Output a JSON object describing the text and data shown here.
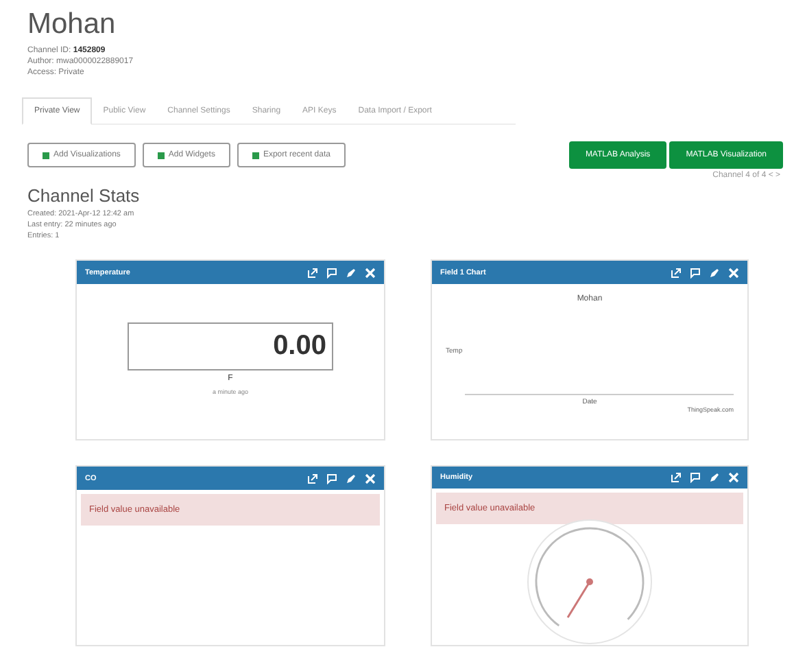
{
  "channel": {
    "name": "Mohan",
    "id_label": "Channel ID: ",
    "id": "1452809",
    "author": "Author: mwa0000022889017",
    "access": "Access: Private"
  },
  "tabs": [
    {
      "label": "Private View",
      "selected": true
    },
    {
      "label": "Public View",
      "selected": false
    },
    {
      "label": "Channel Settings",
      "selected": false
    },
    {
      "label": "Sharing",
      "selected": false
    },
    {
      "label": "API Keys",
      "selected": false
    },
    {
      "label": "Data Import / Export",
      "selected": false
    }
  ],
  "actions": [
    "Add Visualizations",
    "Add Widgets",
    "Export recent data"
  ],
  "matlab_buttons": [
    "MATLAB Analysis",
    "MATLAB Visualization"
  ],
  "pager": "Channel 4 of 4  <  >",
  "stats": {
    "title": "Channel Stats",
    "created": "Created: 2021-Apr-12 12:42 am",
    "last_entry": "Last entry: 22 minutes ago",
    "entries": "Entries: 1"
  },
  "widgets": [
    {
      "kind": "numeric",
      "title": "Temperature",
      "value": "0.00",
      "unit": "F",
      "time": "a minute ago"
    },
    {
      "kind": "chart",
      "title": "Field 1 Chart",
      "chart_title": "Mohan",
      "ylabel": "Temp",
      "xlabel": "Date",
      "credit": "ThingSpeak.com"
    },
    {
      "kind": "message",
      "title": "CO",
      "message": "Field value unavailable"
    },
    {
      "kind": "gauge",
      "title": "Humidity",
      "message": "Field value unavailable"
    }
  ]
}
